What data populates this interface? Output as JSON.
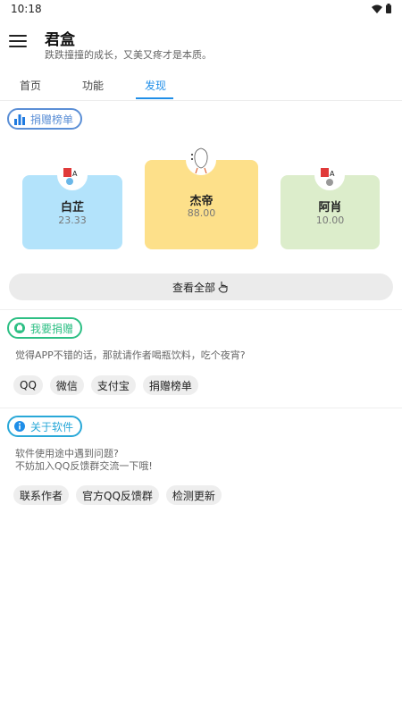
{
  "status_bar": {
    "time": "10:18",
    "icons": [
      "wifi-icon",
      "battery-icon"
    ]
  },
  "app_bar": {
    "title": "君盒",
    "subtitle": "跌跌撞撞的成长，又美又疼才是本质。",
    "menu_icon": "menu-icon"
  },
  "tabs": [
    {
      "label": "首页",
      "active": false
    },
    {
      "label": "功能",
      "active": false
    },
    {
      "label": "发现",
      "active": true
    }
  ],
  "ranking": {
    "header": "捐赠榜单",
    "header_icon": "bar-chart-icon",
    "entries": [
      {
        "rank": 2,
        "name": "白芷",
        "amount": "23.33",
        "color": "#b3e3fb"
      },
      {
        "rank": 1,
        "name": "杰帝",
        "amount": "88.00",
        "color": "#fde08a"
      },
      {
        "rank": 3,
        "name": "阿肖",
        "amount": "10.00",
        "color": "#dcedcb"
      }
    ],
    "view_all_label": "查看全部",
    "view_all_icon": "hand-pointer-icon"
  },
  "donate": {
    "header": "我要捐赠",
    "header_icon": "wallet-icon",
    "description": "觉得APP不错的话，那就请作者喝瓶饮料，吃个夜宵?",
    "buttons": [
      "QQ",
      "微信",
      "支付宝",
      "捐赠榜单"
    ]
  },
  "about": {
    "header": "关于软件",
    "header_icon": "info-icon",
    "description_lines": [
      "软件使用途中遇到问题?",
      "不妨加入QQ反馈群交流一下哦!"
    ],
    "buttons": [
      "联系作者",
      "官方QQ反馈群",
      "检测更新"
    ]
  },
  "colors": {
    "accent": "#1f8ee8",
    "ranking_chip": "#5b8fd6",
    "donate_chip": "#2dbf84",
    "about_chip": "#29a8d8"
  }
}
